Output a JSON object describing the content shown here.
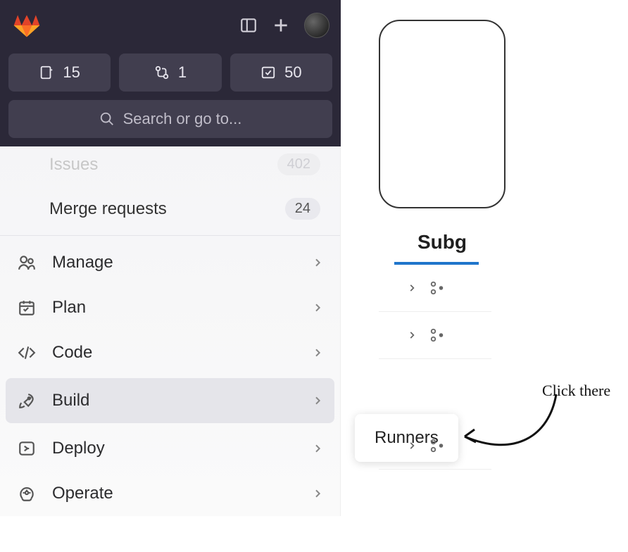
{
  "header": {
    "counters": {
      "merge_requests": "15",
      "open_mrs": "1",
      "todos": "50"
    },
    "search_placeholder": "Search or go to..."
  },
  "nav": {
    "issues": {
      "label": "Issues",
      "count": "402"
    },
    "merge_requests": {
      "label": "Merge requests",
      "count": "24"
    },
    "items": [
      {
        "label": "Manage"
      },
      {
        "label": "Plan"
      },
      {
        "label": "Code"
      },
      {
        "label": "Build"
      },
      {
        "label": "Deploy"
      },
      {
        "label": "Operate"
      }
    ]
  },
  "flyout": {
    "label": "Runners"
  },
  "context": {
    "tab": "Subg"
  },
  "annotation": {
    "text": "Click there"
  }
}
